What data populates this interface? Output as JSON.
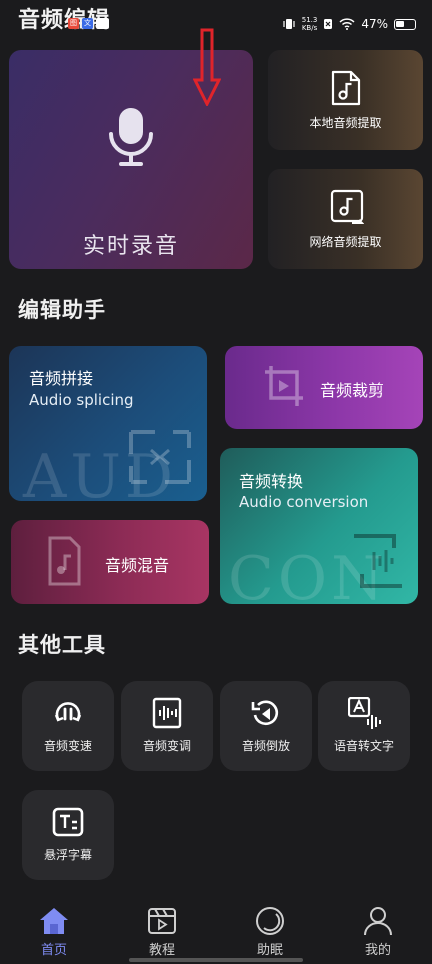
{
  "status_bar": {
    "app_title": "音频编辑",
    "net_speed": "51.3",
    "net_unit": "KB/s",
    "battery": "47%",
    "notif": [
      "图",
      "文"
    ]
  },
  "hero": {
    "record_label": "实时录音",
    "local_extract": "本地音频提取",
    "network_extract": "网络音频提取"
  },
  "sections": {
    "edit_helper": "编辑助手",
    "other_tools": "其他工具"
  },
  "edit_cards": {
    "splice": {
      "title": "音频拼接",
      "subtitle": "Audio splicing",
      "bg_text": "AUD"
    },
    "cut": {
      "title": "音频裁剪"
    },
    "conversion": {
      "title": "音频转换",
      "subtitle": "Audio conversion",
      "bg_text": "CON"
    },
    "mix": {
      "title": "音频混音"
    }
  },
  "tools": [
    {
      "label": "音频变速",
      "icon": "speed-icon"
    },
    {
      "label": "音频变调",
      "icon": "pitch-icon"
    },
    {
      "label": "音频倒放",
      "icon": "reverse-icon"
    },
    {
      "label": "语音转文字",
      "icon": "speech-to-text-icon"
    },
    {
      "label": "悬浮字幕",
      "icon": "subtitle-icon"
    }
  ],
  "nav": [
    {
      "label": "首页",
      "icon": "home-icon"
    },
    {
      "label": "教程",
      "icon": "video-icon"
    },
    {
      "label": "助眠",
      "icon": "moon-icon"
    },
    {
      "label": "我的",
      "icon": "user-icon"
    }
  ],
  "colors": {
    "accent": "#7f8cf2",
    "annotation_arrow": "#e0242a"
  }
}
